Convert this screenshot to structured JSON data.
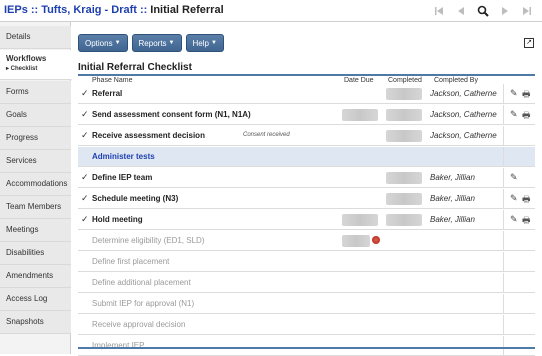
{
  "breadcrumb": {
    "root": "IEPs",
    "student": "Tufts, Kraig - Draft",
    "current": "Initial Referral",
    "separator": "::"
  },
  "nav": {
    "first": "|◀",
    "prev": "◀",
    "search": "search-icon",
    "next": "▶",
    "last": "▶|"
  },
  "sidebar": {
    "items": [
      {
        "label": "Details"
      },
      {
        "label": "Workflows",
        "sub": "▸ Checklist",
        "active": true
      },
      {
        "label": "Forms"
      },
      {
        "label": "Goals"
      },
      {
        "label": "Progress"
      },
      {
        "label": "Services"
      },
      {
        "label": "Accommodations"
      },
      {
        "label": "Team Members"
      },
      {
        "label": "Meetings"
      },
      {
        "label": "Disabilities"
      },
      {
        "label": "Amendments"
      },
      {
        "label": "Access Log"
      },
      {
        "label": "Snapshots"
      }
    ]
  },
  "toolbar": {
    "options": "Options",
    "reports": "Reports",
    "help": "Help"
  },
  "checklist": {
    "title": "Initial Referral Checklist",
    "columns": {
      "phase": "Phase Name",
      "date_due": "Date Due",
      "completed": "Completed",
      "completed_by": "Completed By"
    },
    "rows": [
      {
        "phase": "Referral",
        "checked": true,
        "completed_by": "Jackson, Catherne",
        "note": ""
      },
      {
        "phase": "Send assessment consent form (N1, N1A)",
        "checked": true,
        "completed_by": "Jackson, Catherne",
        "note": ""
      },
      {
        "phase": "Receive assessment decision",
        "checked": true,
        "completed_by": "Jackson, Catherne",
        "note": "Consent received"
      },
      {
        "phase": "Administer tests",
        "group": true
      },
      {
        "phase": "Define IEP team",
        "checked": true,
        "completed_by": "Baker, Jillian",
        "note": ""
      },
      {
        "phase": "Schedule meeting (N3)",
        "checked": true,
        "completed_by": "Baker, Jillian",
        "note": ""
      },
      {
        "phase": "Hold meeting",
        "checked": true,
        "completed_by": "Baker, Jillian",
        "note": ""
      },
      {
        "phase": "Determine eligibility (ED1, SLD)",
        "disabled": true
      },
      {
        "phase": "Define first placement",
        "disabled": true
      },
      {
        "phase": "Define additional placement",
        "disabled": true
      },
      {
        "phase": "Submit IEP for approval (N1)",
        "disabled": true
      },
      {
        "phase": "Receive approval decision",
        "disabled": true
      },
      {
        "phase": "Implement IEP",
        "disabled": true
      }
    ]
  },
  "colors": {
    "link": "#1d3fb0",
    "accent": "#4f7aa8",
    "button": "#3f6591",
    "group_row": "#dfe7f2"
  }
}
